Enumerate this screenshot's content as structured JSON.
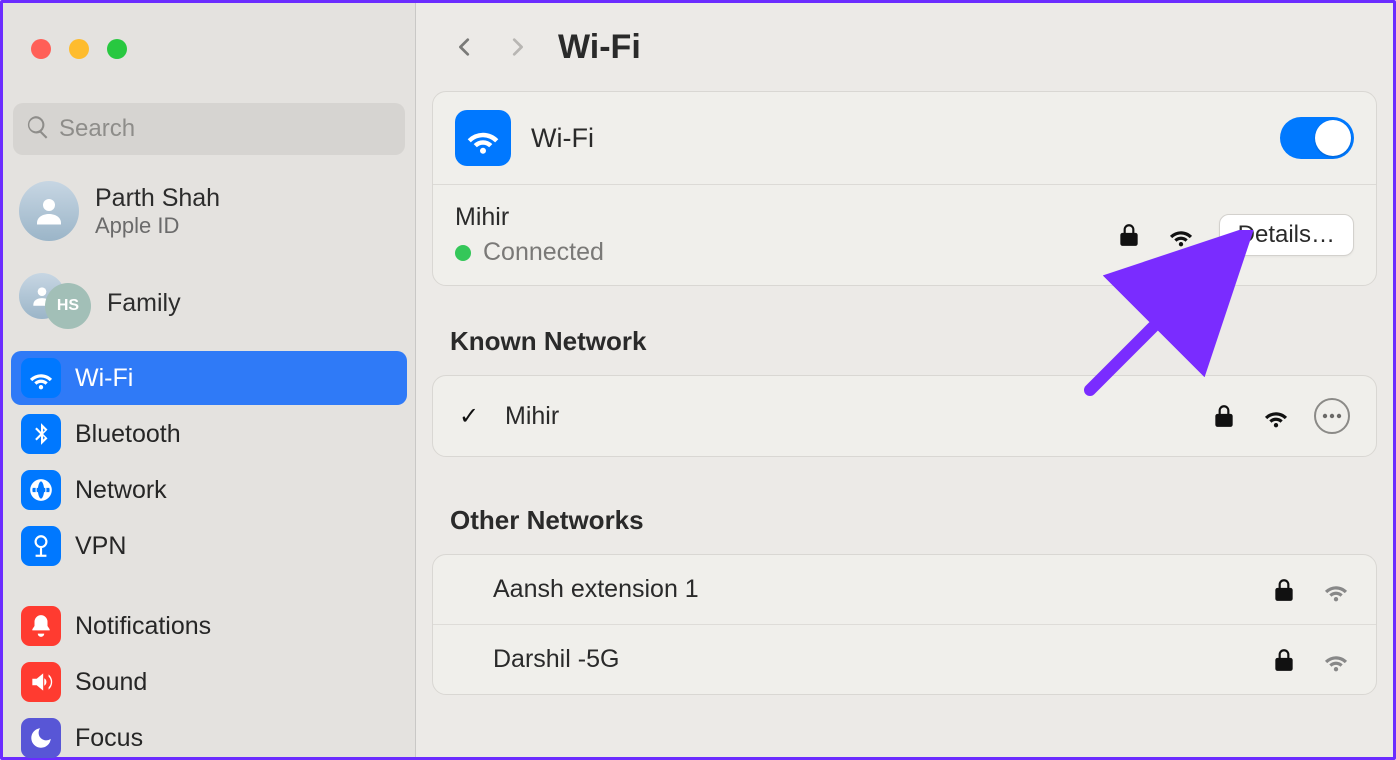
{
  "search": {
    "placeholder": "Search"
  },
  "account": {
    "name": "Parth Shah",
    "sub": "Apple ID",
    "family_label": "Family",
    "family_initials": "HS"
  },
  "sidebar": {
    "items": [
      {
        "id": "wifi",
        "label": "Wi-Fi",
        "color": "ic-blue",
        "icon": "wifi"
      },
      {
        "id": "bluetooth",
        "label": "Bluetooth",
        "color": "ic-blue",
        "icon": "bluetooth"
      },
      {
        "id": "network",
        "label": "Network",
        "color": "ic-blue",
        "icon": "globe"
      },
      {
        "id": "vpn",
        "label": "VPN",
        "color": "ic-blue",
        "icon": "vpn"
      }
    ],
    "items2": [
      {
        "id": "notifications",
        "label": "Notifications",
        "color": "ic-red",
        "icon": "bell"
      },
      {
        "id": "sound",
        "label": "Sound",
        "color": "ic-red",
        "icon": "sound"
      },
      {
        "id": "focus",
        "label": "Focus",
        "color": "ic-purple",
        "icon": "moon"
      }
    ],
    "selected": "wifi"
  },
  "page": {
    "title": "Wi-Fi"
  },
  "wifi": {
    "label": "Wi-Fi",
    "enabled": true,
    "connected": {
      "ssid": "Mihir",
      "status": "Connected",
      "status_color": "#34c759",
      "details_label": "Details…",
      "secured": true
    }
  },
  "known": {
    "title": "Known Network",
    "items": [
      {
        "ssid": "Mihir",
        "connected": true,
        "secured": true
      }
    ]
  },
  "other": {
    "title": "Other Networks",
    "items": [
      {
        "ssid": "Aansh extension 1",
        "secured": true,
        "strength": "weak"
      },
      {
        "ssid": "Darshil -5G",
        "secured": true,
        "strength": "weak"
      }
    ]
  },
  "colors": {
    "accent": "#0079ff",
    "annotation": "#7a2cff"
  }
}
